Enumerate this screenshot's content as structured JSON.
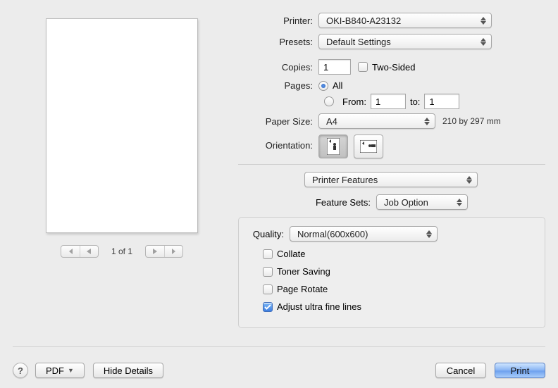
{
  "labels": {
    "printer": "Printer:",
    "presets": "Presets:",
    "copies": "Copies:",
    "two_sided": "Two-Sided",
    "pages": "Pages:",
    "all": "All",
    "from": "From:",
    "to": "to:",
    "paper_size": "Paper Size:",
    "orientation": "Orientation:",
    "feature_sets": "Feature Sets:",
    "quality": "Quality:"
  },
  "values": {
    "printer": "OKI-B840-A23132",
    "presets": "Default Settings",
    "copies": "1",
    "two_sided_checked": false,
    "pages_mode": "all",
    "from": "1",
    "to": "1",
    "paper_size": "A4",
    "paper_size_note": "210 by 297 mm",
    "orientation": "portrait",
    "features_section": "Printer Features",
    "feature_set": "Job Option",
    "quality": "Normal(600x600)"
  },
  "feature_checks": {
    "collate": {
      "label": "Collate",
      "checked": false
    },
    "toner_saving": {
      "label": "Toner Saving",
      "checked": false
    },
    "page_rotate": {
      "label": "Page Rotate",
      "checked": false
    },
    "adjust_ultra_fine": {
      "label": "Adjust ultra fine lines",
      "checked": true
    }
  },
  "pager": {
    "label": "1 of 1"
  },
  "footer": {
    "help": "?",
    "pdf": "PDF",
    "hide_details": "Hide Details",
    "cancel": "Cancel",
    "print": "Print"
  }
}
